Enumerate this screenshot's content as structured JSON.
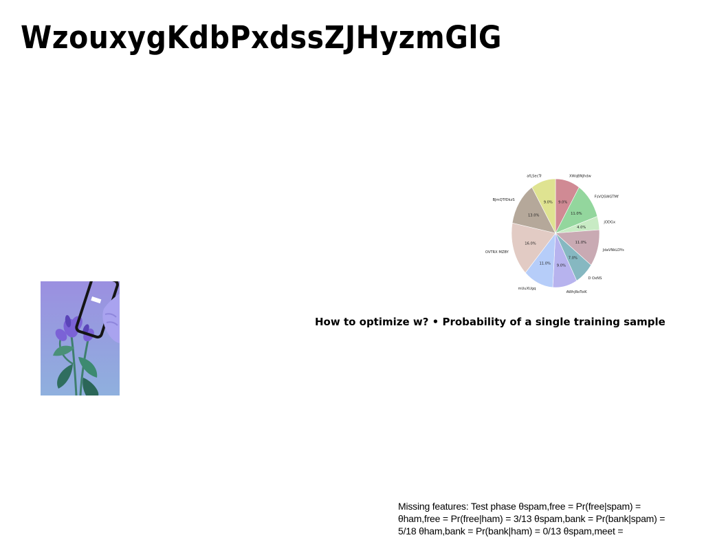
{
  "slide": {
    "title": "WzouxygKdbPxdssZJHyzmGlG",
    "subtitle": "How to optimize w? • Probability of a single training sample",
    "body_lines": [
      "Missing features: Test phase θspam,free = Pr(free|spam) =",
      "θham,free = Pr(free|ham) = 3/13 θspam,bank = Pr(bank|spam) =",
      "5/18 θham,bank = Pr(bank|ham) = 0/13 θspam,meet ="
    ]
  },
  "photo": {
    "icon": "hand-holding-phone-with-flowers-photo",
    "colors": {
      "background_top": "#9b8fe0",
      "background_bottom": "#8fb0de",
      "leaf": "#3f7f6e",
      "flower": "#7b62d6"
    }
  },
  "chart_data": {
    "type": "pie",
    "title": "",
    "slices": [
      {
        "label": "XWqBNJhdw",
        "value": 9.0,
        "pct_label": "9.0%",
        "color": "#d08a94"
      },
      {
        "label": "FsVQSWGTMf",
        "value": 11.0,
        "pct_label": "11.0%",
        "color": "#93d69d"
      },
      {
        "label": "jODGx",
        "value": 4.0,
        "pct_label": "4.0%",
        "color": "#c8ebc4"
      },
      {
        "label": "JdaVNkLDYs",
        "value": 11.0,
        "pct_label": "11.0%",
        "color": "#c9aab3"
      },
      {
        "label": "D OxNS",
        "value": 7.0,
        "pct_label": "7.0%",
        "color": "#86b8c1"
      },
      {
        "label": "AWhjRoToiK",
        "value": 9.0,
        "pct_label": "9.0%",
        "color": "#b7b3ee"
      },
      {
        "label": "mUuXUgq",
        "value": 11.0,
        "pct_label": "11.0%",
        "color": "#b6cdf9"
      },
      {
        "label": "OVTRX MZBY",
        "value": 16.0,
        "pct_label": "16.0%",
        "color": "#e2cbc4"
      },
      {
        "label": "BJmQTfDkzS",
        "value": 13.0,
        "pct_label": "13.0%",
        "color": "#b5a89a"
      },
      {
        "label": "afLSecTr",
        "value": 9.0,
        "pct_label": "9.0%",
        "color": "#dfe391"
      }
    ],
    "start_angle_deg": 90,
    "direction": "clockwise",
    "legend": "none"
  }
}
